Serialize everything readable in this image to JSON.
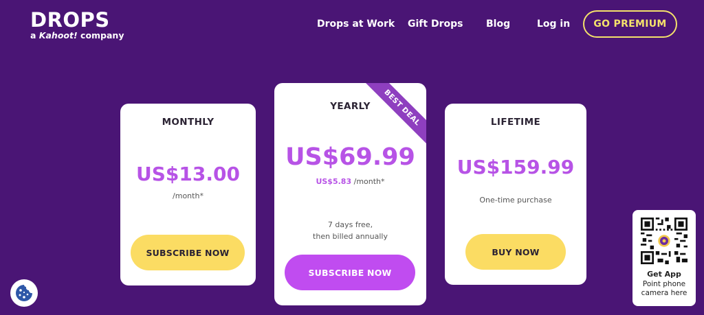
{
  "brand": {
    "name": "DROPS",
    "tagline_prefix": "a",
    "tagline_brand": "Kahoot!",
    "tagline_suffix": "company"
  },
  "nav": {
    "items": [
      "Drops at Work",
      "Gift Drops",
      "Blog",
      "Log in"
    ],
    "premium_label": "GO PREMIUM"
  },
  "plans": {
    "monthly": {
      "title": "MONTHLY",
      "price": "US$13.00",
      "period": "/month*",
      "button": "SUBSCRIBE NOW"
    },
    "yearly": {
      "title": "YEARLY",
      "ribbon": "BEST DEAL",
      "price": "US$69.99",
      "sub_price": "US$5.83",
      "sub_period": "/month*",
      "note_line1": "7 days free,",
      "note_line2": "then billed annually",
      "button": "SUBSCRIBE NOW"
    },
    "lifetime": {
      "title": "LIFETIME",
      "price": "US$159.99",
      "note": "One-time purchase",
      "button": "BUY NOW"
    }
  },
  "get_app": {
    "title": "Get App",
    "desc_line1": "Point phone",
    "desc_line2": "camera here"
  },
  "colors": {
    "background": "#4a1575",
    "accent_yellow": "#fbdc63",
    "accent_purple": "#c04cf0",
    "price_purple": "#b753e6",
    "ribbon": "#8e3fbf"
  },
  "icons": {
    "cookie": "cookie-icon",
    "qr": "qr-code-icon"
  }
}
